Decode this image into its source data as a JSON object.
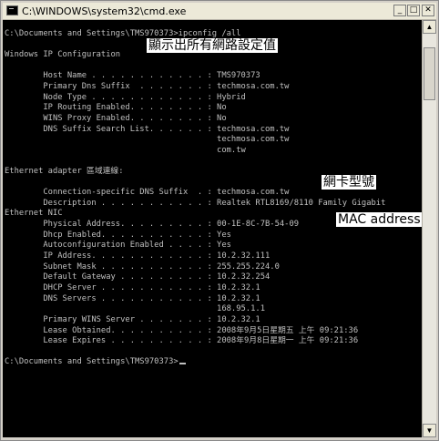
{
  "window": {
    "title": "C:\\WINDOWS\\system32\\cmd.exe",
    "minimize_label": "_",
    "maximize_label": "□",
    "close_label": "✕"
  },
  "console": {
    "lines": [
      "C:\\Documents and Settings\\TMS970373>ipconfig /all",
      "Windows IP Configuration",
      "        Host Name . . . . . . . . . . . . : TMS970373",
      "        Primary Dns Suffix  . . . . . . . : techmosa.com.tw",
      "        Node Type . . . . . . . . . . . . : Hybrid",
      "        IP Routing Enabled. . . . . . . . : No",
      "        WINS Proxy Enabled. . . . . . . . : No",
      "        DNS Suffix Search List. . . . . . : techmosa.com.tw",
      "                                            techmosa.com.tw",
      "                                            com.tw",
      "Ethernet adapter 區域連線:",
      "        Connection-specific DNS Suffix  . : techmosa.com.tw",
      "        Description . . . . . . . . . . . : Realtek RTL8169/8110 Family Gigabit",
      "Ethernet NIC",
      "        Physical Address. . . . . . . . . : 00-1E-8C-7B-54-09",
      "        Dhcp Enabled. . . . . . . . . . . : Yes",
      "        Autoconfiguration Enabled . . . . : Yes",
      "        IP Address. . . . . . . . . . . . : 10.2.32.111",
      "        Subnet Mask . . . . . . . . . . . : 255.255.224.0",
      "        Default Gateway . . . . . . . . . : 10.2.32.254",
      "        DHCP Server . . . . . . . . . . . : 10.2.32.1",
      "        DNS Servers . . . . . . . . . . . : 10.2.32.1",
      "                                            168.95.1.1",
      "        Primary WINS Server . . . . . . . : 10.2.32.1",
      "        Lease Obtained. . . . . . . . . . : 2008年9月5日星期五 上午 09:21:36",
      "        Lease Expires . . . . . . . . . . : 2008年9月8日星期一 上午 09:21:36",
      "C:\\Documents and Settings\\TMS970373>"
    ]
  },
  "annotations": {
    "show_all_settings": "顯示出所有網路設定值",
    "nic_model": "網卡型號",
    "mac_address": "MAC address"
  },
  "scrollbar": {
    "up_arrow": "▲",
    "down_arrow": "▼"
  }
}
